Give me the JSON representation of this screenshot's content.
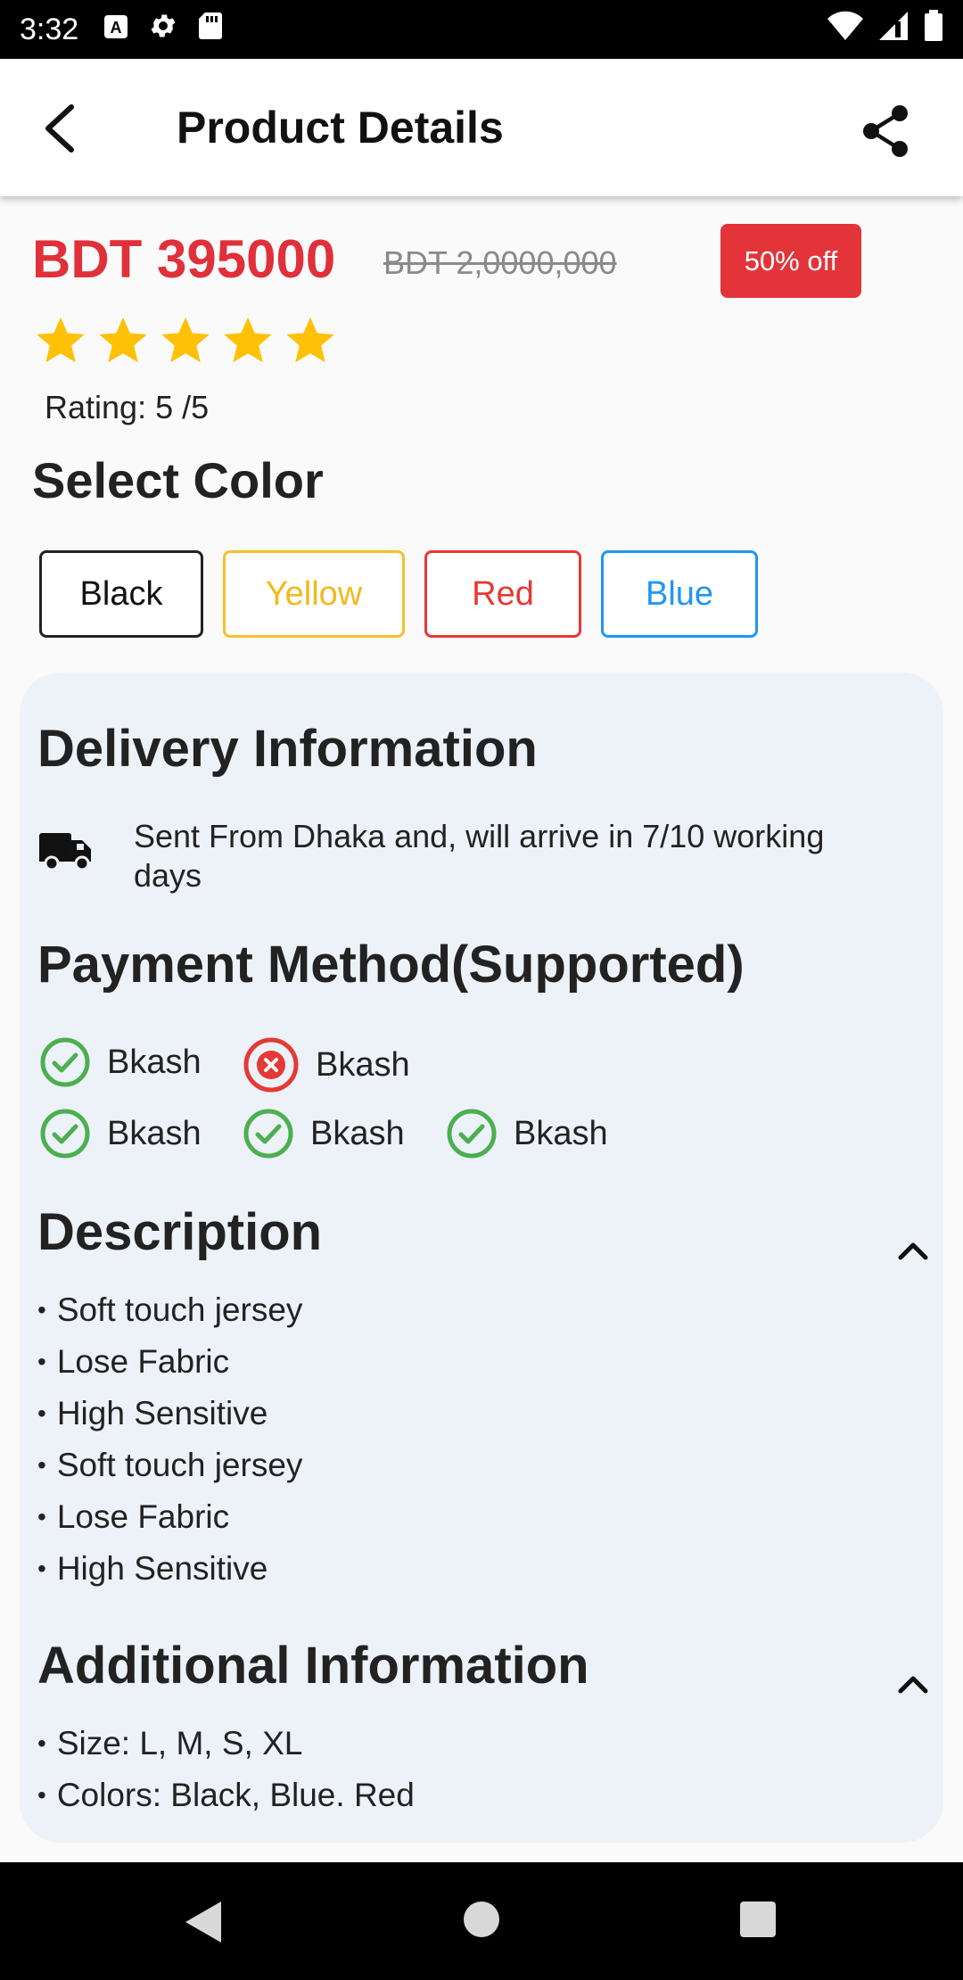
{
  "status_bar": {
    "time": "3:32"
  },
  "app_bar": {
    "title": "Product Details"
  },
  "product": {
    "price": "BDT 395000",
    "old_price": "BDT 2,0000,000",
    "discount": "50% off",
    "rating_value": 5,
    "rating_max": 5,
    "rating_text": "Rating: 5 /5"
  },
  "color_section": {
    "title": "Select Color",
    "options": [
      "Black",
      "Yellow",
      "Red",
      "Blue"
    ],
    "colors": {
      "black": "#222222",
      "yellow": "#F3B820",
      "red": "#E53935",
      "blue": "#2196F3"
    }
  },
  "delivery": {
    "title": "Delivery Information",
    "text": "Sent From Dhaka and, will arrive in 7/10 working days"
  },
  "payment": {
    "title": "Payment Method(Supported)",
    "methods": [
      {
        "label": "Bkash",
        "supported": true
      },
      {
        "label": "Bkash",
        "supported": false
      },
      {
        "label": "Bkash",
        "supported": true
      },
      {
        "label": "Bkash",
        "supported": true
      },
      {
        "label": "Bkash",
        "supported": true
      }
    ]
  },
  "description": {
    "title": "Description",
    "items": [
      "Soft touch jersey",
      "Lose Fabric",
      "High Sensitive",
      "Soft touch jersey",
      "Lose Fabric",
      "High Sensitive"
    ]
  },
  "additional": {
    "title": "Additional Information",
    "items": [
      "Size: L, M, S, XL",
      "Colors: Black, Blue. Red"
    ]
  },
  "theme": {
    "accent_red": "#E3343A",
    "star": "#FFC107",
    "check_green": "#4CAF50",
    "card_bg": "#EDF2F8"
  }
}
